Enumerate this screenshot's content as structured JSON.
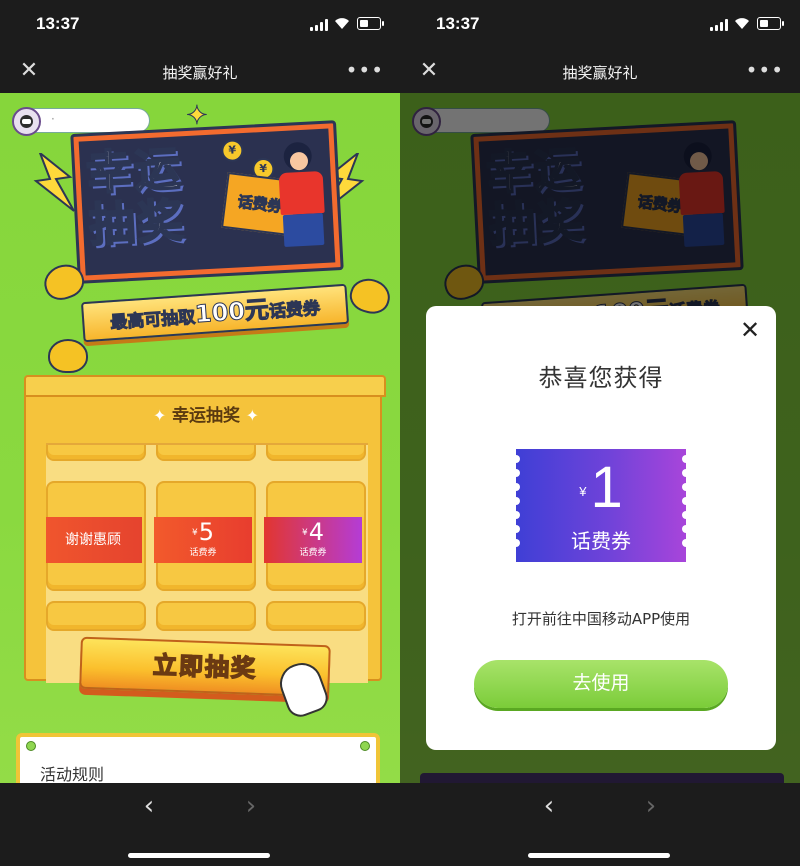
{
  "status": {
    "time": "13:37"
  },
  "nav": {
    "title": "抽奖赢好礼",
    "close_glyph": "✕",
    "more_glyph": "•••",
    "back_glyph": "‹",
    "forward_glyph": "›"
  },
  "user": {
    "name": "·"
  },
  "banner": {
    "title_line1": "幸运",
    "title_line2": "抽奖",
    "ticket_text": "话费券",
    "coin_symbol": "¥",
    "subtitle_prefix": "最高可抽取",
    "subtitle_amount": "100元",
    "subtitle_suffix": "话费券"
  },
  "panel": {
    "title": "幸运抽奖",
    "prizes": [
      {
        "type": "thanks",
        "text": "谢谢惠顾"
      },
      {
        "type": "coupon",
        "currency": "¥",
        "amount": "5",
        "label": "话费券"
      },
      {
        "type": "coupon",
        "currency": "¥",
        "amount": "4",
        "label": "话费券"
      }
    ]
  },
  "draw_button": {
    "label": "立即抽奖"
  },
  "rules": {
    "title": "活动规则"
  },
  "modal": {
    "title": "恭喜您获得",
    "close_glyph": "✕",
    "coupon_currency": "¥",
    "coupon_amount": "1",
    "coupon_label": "话费券",
    "description": "打开前往中国移动APP使用",
    "use_button_label": "去使用"
  },
  "colors": {
    "page_green": "#86d63b",
    "panel_gold": "#f5c33b",
    "coupon_start": "#3f3fd6",
    "coupon_end": "#a845da",
    "use_button": "#7bcc39"
  }
}
